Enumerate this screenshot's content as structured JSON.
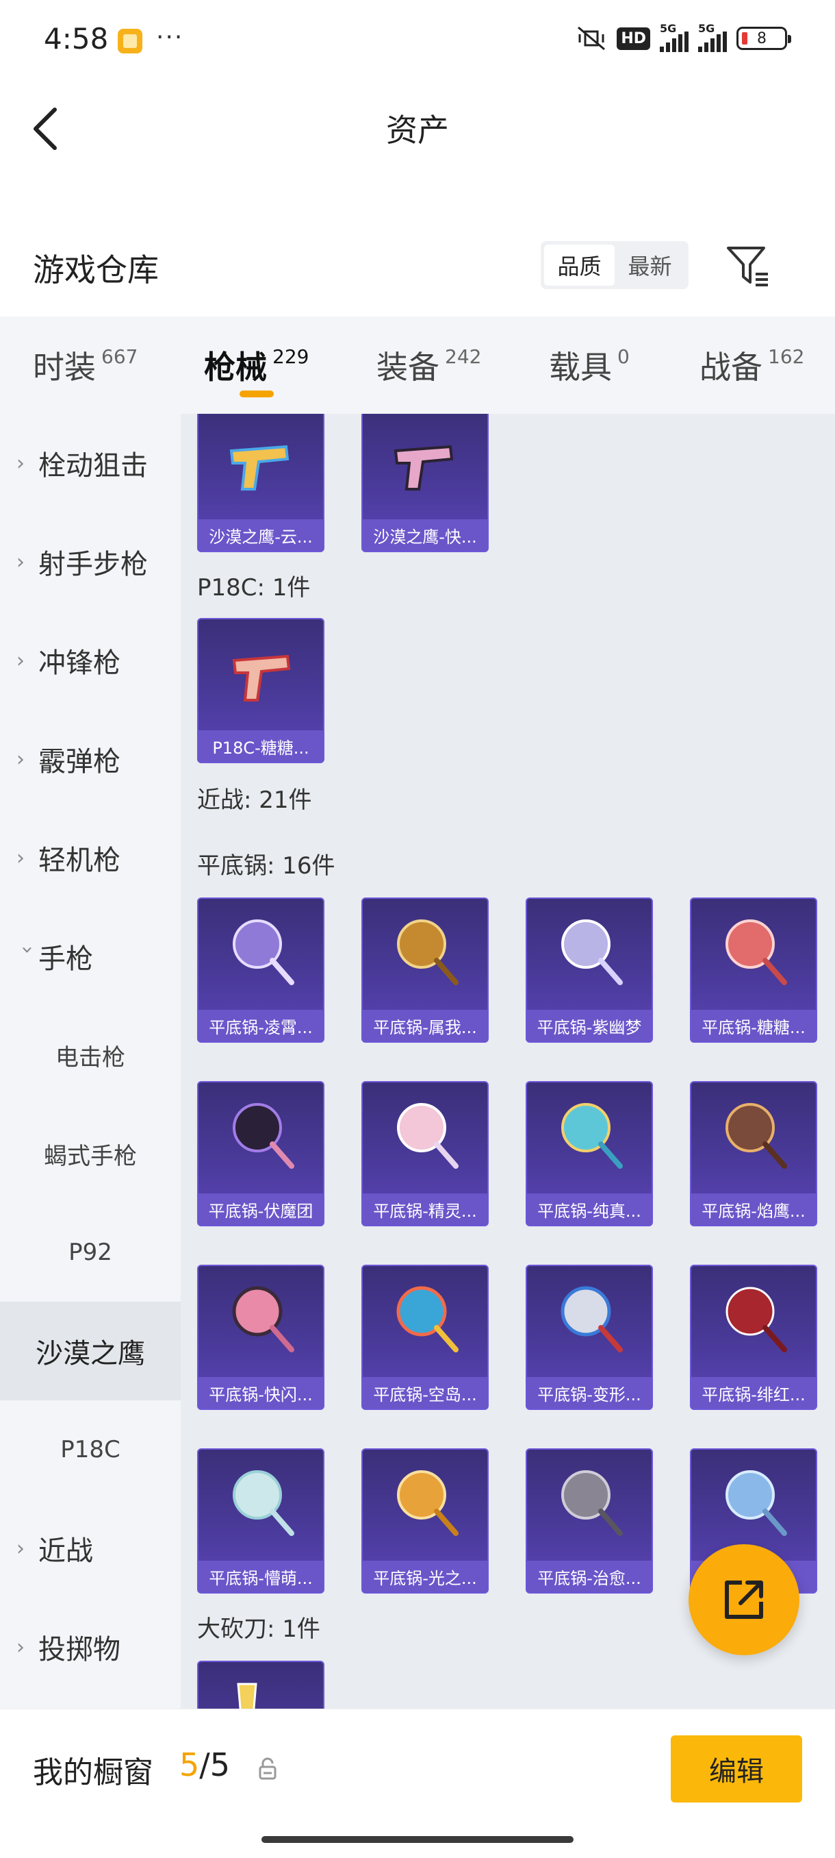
{
  "status_bar": {
    "time": "4:58",
    "more": "···",
    "hd": "HD",
    "sig1": "5G",
    "sig2": "5G",
    "battery": "8"
  },
  "header": {
    "title": "资产"
  },
  "warehouse": {
    "title": "游戏仓库",
    "sort_options": [
      "品质",
      "最新"
    ],
    "active_sort": "品质"
  },
  "category_tabs": [
    {
      "name": "时装",
      "count": "667"
    },
    {
      "name": "枪械",
      "count": "229",
      "active": true
    },
    {
      "name": "装备",
      "count": "242"
    },
    {
      "name": "载具",
      "count": "0"
    },
    {
      "name": "战备",
      "count": "162"
    }
  ],
  "sidebar": [
    {
      "label": "栓动狙击",
      "type": "group",
      "expanded": false
    },
    {
      "label": "射手步枪",
      "type": "group",
      "expanded": false
    },
    {
      "label": "冲锋枪",
      "type": "group",
      "expanded": false
    },
    {
      "label": "霰弹枪",
      "type": "group",
      "expanded": false
    },
    {
      "label": "轻机枪",
      "type": "group",
      "expanded": false
    },
    {
      "label": "手枪",
      "type": "group",
      "expanded": true
    },
    {
      "label": "电击枪",
      "type": "sub"
    },
    {
      "label": "蝎式手枪",
      "type": "sub"
    },
    {
      "label": "P92",
      "type": "sub"
    },
    {
      "label": "沙漠之鹰",
      "type": "sub",
      "selected": true
    },
    {
      "label": "P18C",
      "type": "sub"
    },
    {
      "label": "近战",
      "type": "group",
      "expanded": false
    },
    {
      "label": "投掷物",
      "type": "group",
      "expanded": false
    }
  ],
  "content": {
    "desert_eagle_items": [
      "沙漠之鹰-云...",
      "沙漠之鹰-快..."
    ],
    "p18c_label": "P18C: 1件",
    "p18c_items": [
      "P18C-糖糖..."
    ],
    "melee_label": "近战: 21件",
    "pan_label": "平底锅: 16件",
    "pan_items": [
      "平底锅-凌霄...",
      "平底锅-属我...",
      "平底锅-紫幽梦",
      "平底锅-糖糖...",
      "平底锅-伏魔团",
      "平底锅-精灵...",
      "平底锅-纯真...",
      "平底锅-焰鹰...",
      "平底锅-快闪...",
      "平底锅-空岛...",
      "平底锅-变形...",
      "平底锅-绯红...",
      "平底锅-懵萌...",
      "平底锅-光之...",
      "平底锅-治愈...",
      ""
    ],
    "machete_label": "大砍刀: 1件"
  },
  "bottom_bar": {
    "label": "我的橱窗",
    "current": "5",
    "separator": "/",
    "total": "5",
    "edit_label": "编辑"
  },
  "colors": {
    "accent": "#f5a300",
    "card_bg": "#4a3a9a",
    "card_caption": "#6a56c9"
  }
}
